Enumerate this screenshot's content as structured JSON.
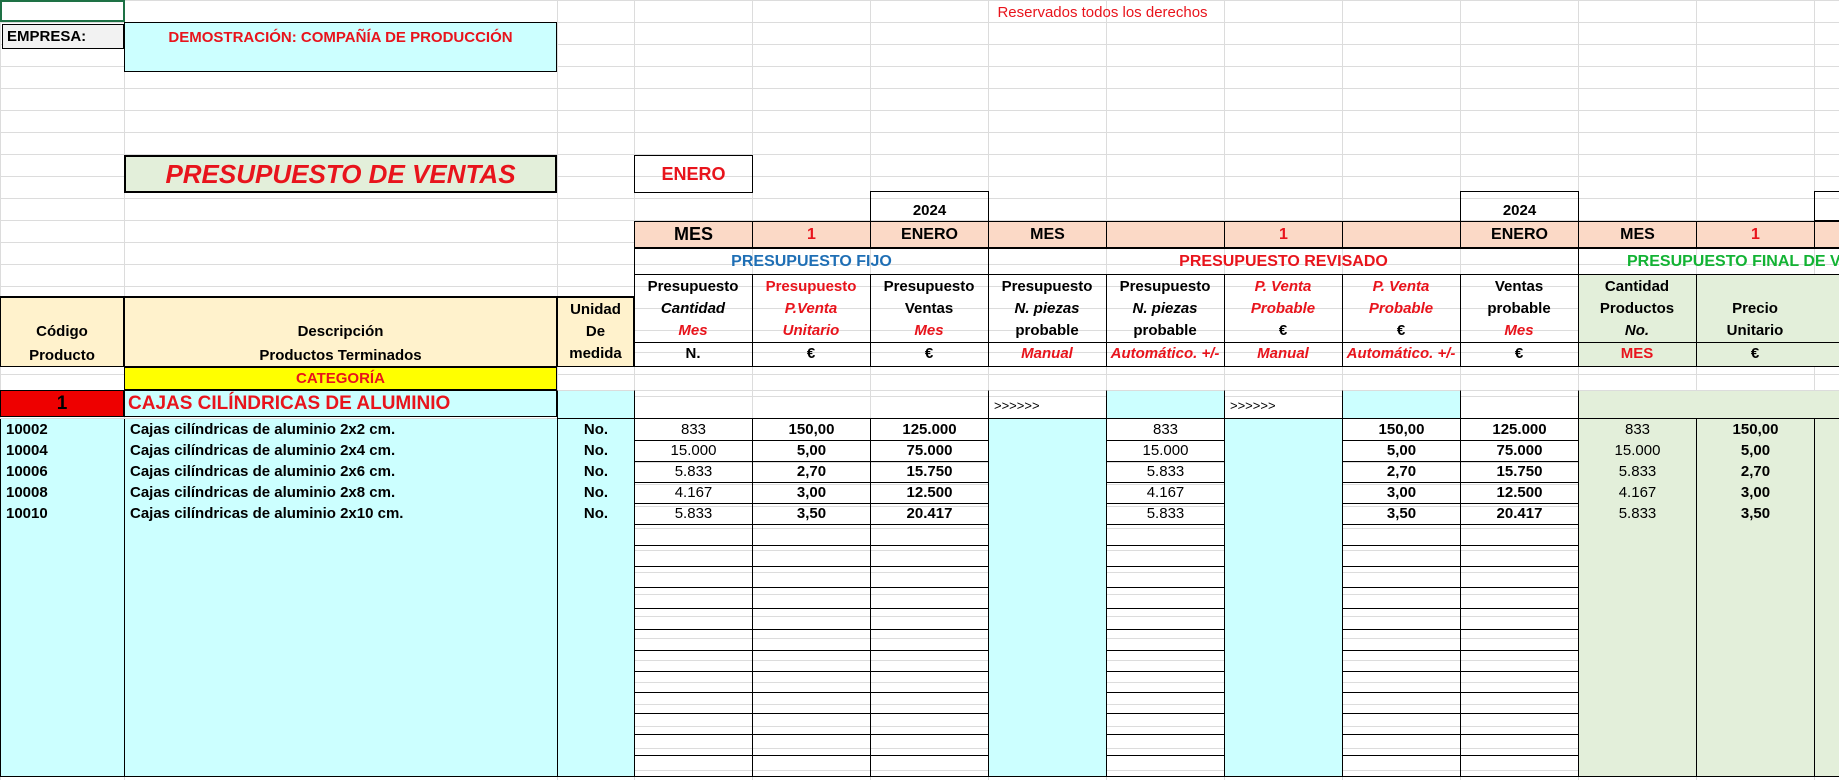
{
  "company_label": "EMPRESA:",
  "company_name": "DEMOSTRACIÓN: COMPAÑÍA DE PRODUCCIÓN",
  "copyright": "Reservados todos los derechos",
  "title": "PRESUPUESTO DE VENTAS",
  "month_box": "ENERO",
  "year_fijo": "2024",
  "year_revisado": "2024",
  "mes_row": {
    "mes1": "MES",
    "num1": "1",
    "mes_name1": "ENERO",
    "mes2": "MES",
    "num2": "1",
    "mes_name2": "ENERO",
    "mes3": "MES",
    "num3": "1"
  },
  "sections": {
    "fijo": "PRESUPUESTO FIJO",
    "revisado": "PRESUPUESTO REVISADO",
    "final": "PRESUPUESTO FINAL DE V"
  },
  "headers": {
    "codigo": [
      "Código",
      "Producto"
    ],
    "descripcion": [
      "Descripción",
      "Productos Terminados"
    ],
    "unidad": [
      "Unidad",
      "De",
      "medida"
    ],
    "cols": [
      [
        "Presupuesto",
        "Cantidad",
        "Mes",
        "N."
      ],
      [
        "Presupuesto",
        "P.Venta",
        "Unitario",
        "€"
      ],
      [
        "Presupuesto",
        "Ventas",
        "Mes",
        "€"
      ],
      [
        "Presupuesto",
        "N. piezas",
        "probable",
        "Manual"
      ],
      [
        "Presupuesto",
        "N. piezas",
        "probable",
        "Automático. +/-"
      ],
      [
        "P. Venta",
        "Probable",
        "€",
        "Manual"
      ],
      [
        "P. Venta",
        "Probable",
        "€",
        "Automático. +/-"
      ],
      [
        "Ventas",
        "probable",
        "Mes",
        "€"
      ],
      [
        "Cantidad",
        "Productos",
        "No.",
        "MES"
      ],
      [
        "",
        "Precio",
        "Unitario",
        "€"
      ]
    ]
  },
  "category_label": "CATEGORÍA",
  "category": {
    "number": "1",
    "name": "CAJAS CILÍNDRICAS DE ALUMINIO",
    "arrow1": ">>>>>>",
    "arrow2": ">>>>>>"
  },
  "rows": [
    {
      "code": "10002",
      "desc": "Cajas cilíndricas de aluminio 2x2 cm.",
      "unit": "No.",
      "qty": "833",
      "price": "150,00",
      "sales": "125.000",
      "rev_qty": "833",
      "rev_price": "150,00",
      "rev_sales": "125.000",
      "fin_qty": "833",
      "fin_price": "150,00"
    },
    {
      "code": "10004",
      "desc": "Cajas cilíndricas de aluminio 2x4 cm.",
      "unit": "No.",
      "qty": "15.000",
      "price": "5,00",
      "sales": "75.000",
      "rev_qty": "15.000",
      "rev_price": "5,00",
      "rev_sales": "75.000",
      "fin_qty": "15.000",
      "fin_price": "5,00"
    },
    {
      "code": "10006",
      "desc": "Cajas cilíndricas de aluminio 2x6 cm.",
      "unit": "No.",
      "qty": "5.833",
      "price": "2,70",
      "sales": "15.750",
      "rev_qty": "5.833",
      "rev_price": "2,70",
      "rev_sales": "15.750",
      "fin_qty": "5.833",
      "fin_price": "2,70"
    },
    {
      "code": "10008",
      "desc": "Cajas cilíndricas de aluminio 2x8 cm.",
      "unit": "No.",
      "qty": "4.167",
      "price": "3,00",
      "sales": "12.500",
      "rev_qty": "4.167",
      "rev_price": "3,00",
      "rev_sales": "12.500",
      "fin_qty": "4.167",
      "fin_price": "3,00"
    },
    {
      "code": "10010",
      "desc": "Cajas cilíndricas de aluminio 2x10 cm.",
      "unit": "No.",
      "qty": "5.833",
      "price": "3,50",
      "sales": "20.417",
      "rev_qty": "5.833",
      "rev_price": "3,50",
      "rev_sales": "20.417",
      "fin_qty": "5.833",
      "fin_price": "3,50"
    }
  ],
  "colors": {
    "red": "#e8141c",
    "blue": "#1f6fb5",
    "green": "#13b334",
    "cyan": "#ccffff",
    "peach": "#fbd9c6",
    "sage": "#e3efda",
    "cream": "#fff2cc",
    "yellow": "#ffff00"
  }
}
